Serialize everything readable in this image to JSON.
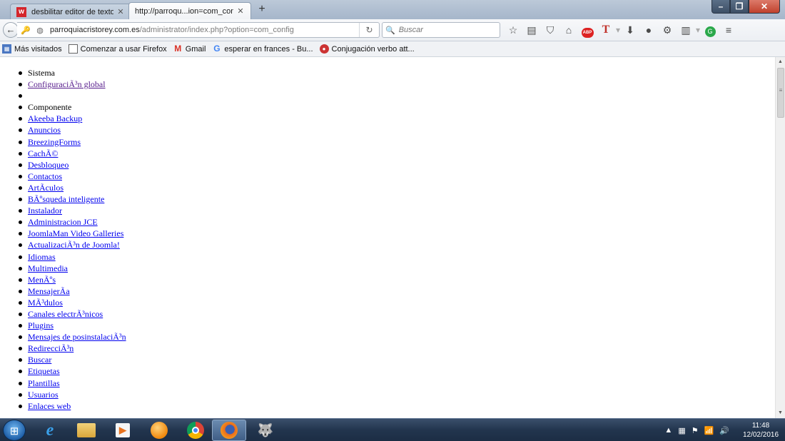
{
  "browser": {
    "tabs": [
      {
        "label": "desbilitar editor de textos e...",
        "favicon": "w"
      },
      {
        "label": "http://parroqu...ion=com_config"
      }
    ],
    "new_tab": "+",
    "url_host": "parroquiacristorey.com.es",
    "url_path": "/administrator/index.php?option=com_config",
    "search_placeholder": "Buscar",
    "window_controls": {
      "minimize": "–",
      "maximize": "❐",
      "close": "✕"
    }
  },
  "bookmarks": [
    {
      "label": "Más visitados",
      "icon": "bookmarks-folder-icon"
    },
    {
      "label": "Comenzar a usar Firefox",
      "icon": "page-icon"
    },
    {
      "label": "Gmail",
      "icon": "gmail-icon",
      "glyph": "M"
    },
    {
      "label": "esperar en frances - Bu...",
      "icon": "google-icon",
      "glyph": "G"
    },
    {
      "label": "Conjugación verbo att...",
      "icon": "conjugacion-icon"
    }
  ],
  "menu": [
    {
      "label": "Sistema",
      "type": "heading"
    },
    {
      "label": "ConfiguraciÃ³n global",
      "type": "link",
      "visited": true
    },
    {
      "label": "",
      "type": "empty"
    },
    {
      "label": "Componente",
      "type": "heading"
    },
    {
      "label": "Akeeba Backup",
      "type": "link"
    },
    {
      "label": "Anuncios",
      "type": "link"
    },
    {
      "label": "BreezingForms",
      "type": "link"
    },
    {
      "label": "CachÃ©",
      "type": "link"
    },
    {
      "label": "Desbloqueo",
      "type": "link"
    },
    {
      "label": "Contactos",
      "type": "link"
    },
    {
      "label": "ArtÃculos",
      "type": "link"
    },
    {
      "label": "BÃºsqueda inteligente",
      "type": "link"
    },
    {
      "label": "Instalador",
      "type": "link"
    },
    {
      "label": "Administracion JCE",
      "type": "link"
    },
    {
      "label": "JoomlaMan Video Galleries",
      "type": "link"
    },
    {
      "label": "ActualizaciÃ³n de Joomla!",
      "type": "link"
    },
    {
      "label": "Idiomas",
      "type": "link"
    },
    {
      "label": "Multimedia",
      "type": "link"
    },
    {
      "label": "MenÃºs",
      "type": "link"
    },
    {
      "label": "MensajerÃa",
      "type": "link"
    },
    {
      "label": "MÃ³dulos",
      "type": "link"
    },
    {
      "label": "Canales electrÃ³nicos",
      "type": "link"
    },
    {
      "label": "Plugins",
      "type": "link"
    },
    {
      "label": "Mensajes de posinstalaciÃ³n",
      "type": "link"
    },
    {
      "label": "RedirecciÃ³n",
      "type": "link"
    },
    {
      "label": "Buscar",
      "type": "link"
    },
    {
      "label": "Etiquetas",
      "type": "link"
    },
    {
      "label": "Plantillas",
      "type": "link"
    },
    {
      "label": "Usuarios",
      "type": "link"
    },
    {
      "label": "Enlaces web",
      "type": "link"
    }
  ],
  "taskbar": {
    "apps": [
      "internet-explorer",
      "file-explorer",
      "media-player",
      "orange-app",
      "chrome",
      "firefox",
      "gimp"
    ],
    "time": "11:48",
    "date": "12/02/2016"
  },
  "colors": {
    "link": "#0000ee",
    "visited_link": "#551a8b",
    "taskbar": "#22354e"
  }
}
